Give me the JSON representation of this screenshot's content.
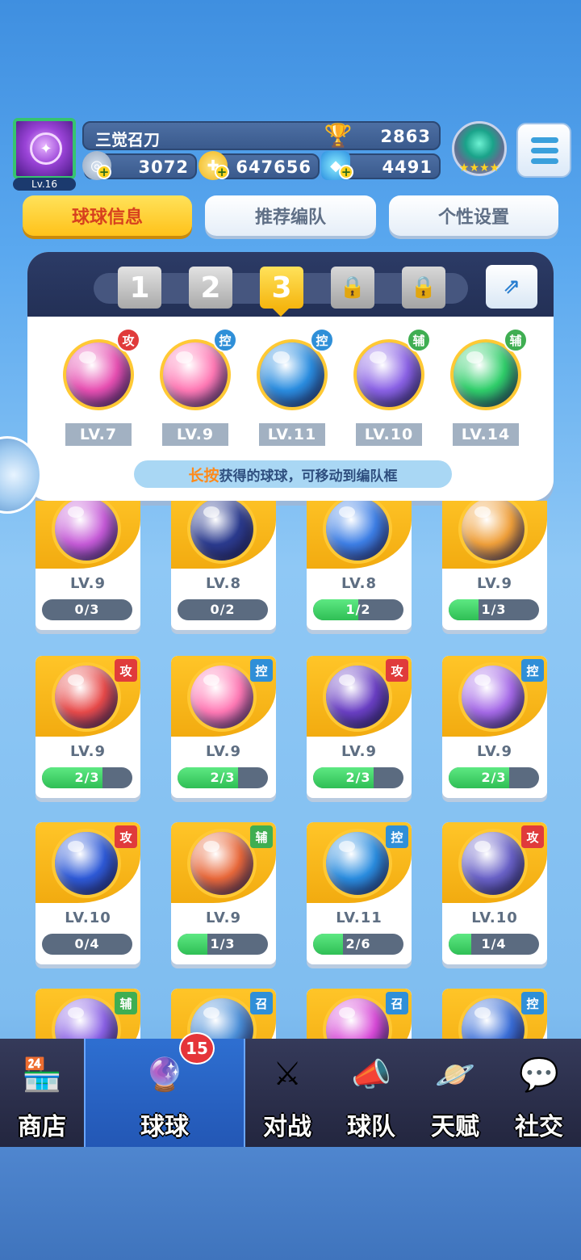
{
  "player": {
    "name": "三觉召刀",
    "level": "Lv.16",
    "trophies": "2863",
    "silver": "3072",
    "gold": "647656",
    "gems": "4491"
  },
  "tabs": [
    {
      "label": "球球信息",
      "active": true
    },
    {
      "label": "推荐编队",
      "active": false
    },
    {
      "label": "个性设置",
      "active": false
    }
  ],
  "team_slots": [
    {
      "label": "1",
      "state": "normal"
    },
    {
      "label": "2",
      "state": "normal"
    },
    {
      "label": "3",
      "state": "active"
    },
    {
      "label": "🔒",
      "state": "locked"
    },
    {
      "label": "🔒",
      "state": "locked"
    }
  ],
  "team_balls": [
    {
      "level": "LV.7",
      "role": "攻",
      "role_color": "#e03b3b",
      "color": "#e74fb2"
    },
    {
      "level": "LV.9",
      "role": "控",
      "role_color": "#2f8fd8",
      "color": "#ff79b5"
    },
    {
      "level": "LV.11",
      "role": "控",
      "role_color": "#2f8fd8",
      "color": "#2a8de0"
    },
    {
      "level": "LV.10",
      "role": "辅",
      "role_color": "#3fae52",
      "color": "#8b62e6"
    },
    {
      "level": "LV.14",
      "role": "辅",
      "role_color": "#3fae52",
      "color": "#2fcf6a"
    }
  ],
  "hint": {
    "emphasis": "长按",
    "text": "获得的球球，可移动到编队框"
  },
  "cards": [
    {
      "level": "LV.9",
      "progress": "0/3",
      "fraction": 0,
      "role": "",
      "color": "#c65bd8"
    },
    {
      "level": "LV.8",
      "progress": "0/2",
      "fraction": 0,
      "role": "",
      "color": "#2b3b8f"
    },
    {
      "level": "LV.8",
      "progress": "1/2",
      "fraction": 0.5,
      "role": "",
      "color": "#3d7fe6"
    },
    {
      "level": "LV.9",
      "progress": "1/3",
      "fraction": 0.33,
      "role": "",
      "color": "#f0a03a"
    },
    {
      "level": "LV.9",
      "progress": "2/3",
      "fraction": 0.67,
      "role": "攻",
      "role_color": "#e03b3b",
      "color": "#e84a4a"
    },
    {
      "level": "LV.9",
      "progress": "2/3",
      "fraction": 0.67,
      "role": "控",
      "role_color": "#2f8fd8",
      "color": "#ff79b5"
    },
    {
      "level": "LV.9",
      "progress": "2/3",
      "fraction": 0.67,
      "role": "攻",
      "role_color": "#e03b3b",
      "color": "#6a3fc4"
    },
    {
      "level": "LV.9",
      "progress": "2/3",
      "fraction": 0.67,
      "role": "控",
      "role_color": "#2f8fd8",
      "color": "#a66ae8"
    },
    {
      "level": "LV.10",
      "progress": "0/4",
      "fraction": 0,
      "role": "攻",
      "role_color": "#e03b3b",
      "color": "#2e5ad8"
    },
    {
      "level": "LV.9",
      "progress": "1/3",
      "fraction": 0.33,
      "role": "辅",
      "role_color": "#3fae52",
      "color": "#e9683a"
    },
    {
      "level": "LV.11",
      "progress": "2/6",
      "fraction": 0.33,
      "role": "控",
      "role_color": "#2f8fd8",
      "color": "#2a8de0"
    },
    {
      "level": "LV.10",
      "progress": "1/4",
      "fraction": 0.25,
      "role": "攻",
      "role_color": "#e03b3b",
      "color": "#6a62c8"
    },
    {
      "level": "",
      "progress": "",
      "fraction": 0,
      "role": "辅",
      "role_color": "#3fae52",
      "color": "#8b62e6"
    },
    {
      "level": "",
      "progress": "",
      "fraction": 0,
      "role": "召",
      "role_color": "#2f8fd8",
      "color": "#4a8ed8"
    },
    {
      "level": "",
      "progress": "",
      "fraction": 0,
      "role": "召",
      "role_color": "#2f8fd8",
      "color": "#d84ad8"
    },
    {
      "level": "",
      "progress": "",
      "fraction": 0,
      "role": "控",
      "role_color": "#2f8fd8",
      "color": "#3a6ed8"
    }
  ],
  "nav": [
    {
      "label": "商店",
      "icon": "🏪",
      "active": false
    },
    {
      "label": "球球",
      "icon": "🔮",
      "active": true,
      "badge": "15"
    },
    {
      "label": "对战",
      "icon": "⚔",
      "active": false
    },
    {
      "label": "球队",
      "icon": "📣",
      "active": false
    },
    {
      "label": "天赋",
      "icon": "🪐",
      "active": false
    },
    {
      "label": "社交",
      "icon": "💬",
      "active": false
    }
  ]
}
